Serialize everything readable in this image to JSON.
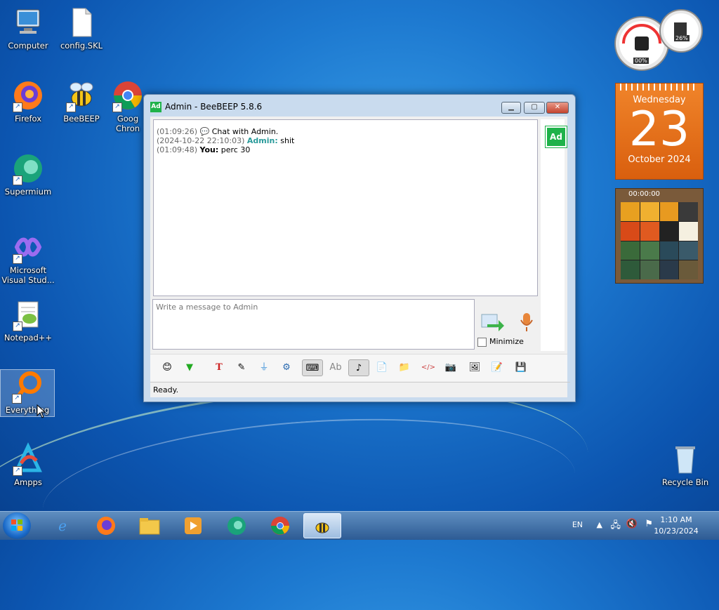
{
  "desktop": {
    "icons": [
      {
        "label": "Computer",
        "icon": "computer-icon"
      },
      {
        "label": "config.SKL",
        "icon": "file-icon"
      },
      {
        "label": "Firefox",
        "icon": "firefox-icon"
      },
      {
        "label": "BeeBEEP",
        "icon": "bee-icon"
      },
      {
        "label": "Goog Chron",
        "icon": "chrome-icon"
      },
      {
        "label": "Supermium",
        "icon": "supermium-icon"
      },
      {
        "label": "Microsoft Visual Stud...",
        "icon": "visual-studio-icon"
      },
      {
        "label": "Notepad++",
        "icon": "notepadpp-icon"
      },
      {
        "label": "Everything",
        "icon": "everything-icon"
      },
      {
        "label": "Ampps",
        "icon": "ampps-icon"
      },
      {
        "label": "Recycle Bin",
        "icon": "recycle-bin-icon"
      }
    ]
  },
  "gadgets": {
    "cpu_label": "00%",
    "mem_label": "26%",
    "calendar": {
      "weekday": "Wednesday",
      "day": "23",
      "month_year": "October 2024"
    },
    "puzzle_timer": "00:00:00"
  },
  "window": {
    "title": "Admin - BeeBEEP 5.8.6",
    "app_badge": "Ad",
    "chat": [
      {
        "ts": "(01:09:26)",
        "text": "Chat with Admin.",
        "type": "system"
      },
      {
        "ts": "(2024-10-22 22:10:03)",
        "name": "Admin:",
        "text": "shit",
        "type": "other"
      },
      {
        "ts": "(01:09:48)",
        "name": "You:",
        "text": "perc 30",
        "type": "me"
      }
    ],
    "avatar": "Ad",
    "compose_placeholder": "Write a message to Admin",
    "minimize_label": "Minimize",
    "status": "Ready.",
    "toolbar": [
      "emoji-icon",
      "down-arrow-icon",
      "font-icon",
      "color-icon",
      "filter-icon",
      "settings-icon",
      "keyboard-icon",
      "spell-icon",
      "note-icon",
      "file-icon",
      "folder-send-icon",
      "html-icon",
      "camera-icon",
      "screenshot-icon",
      "edit-icon",
      "save-icon"
    ]
  },
  "taskbar": {
    "lang": "EN",
    "time": "1:10 AM",
    "date": "10/23/2024"
  }
}
